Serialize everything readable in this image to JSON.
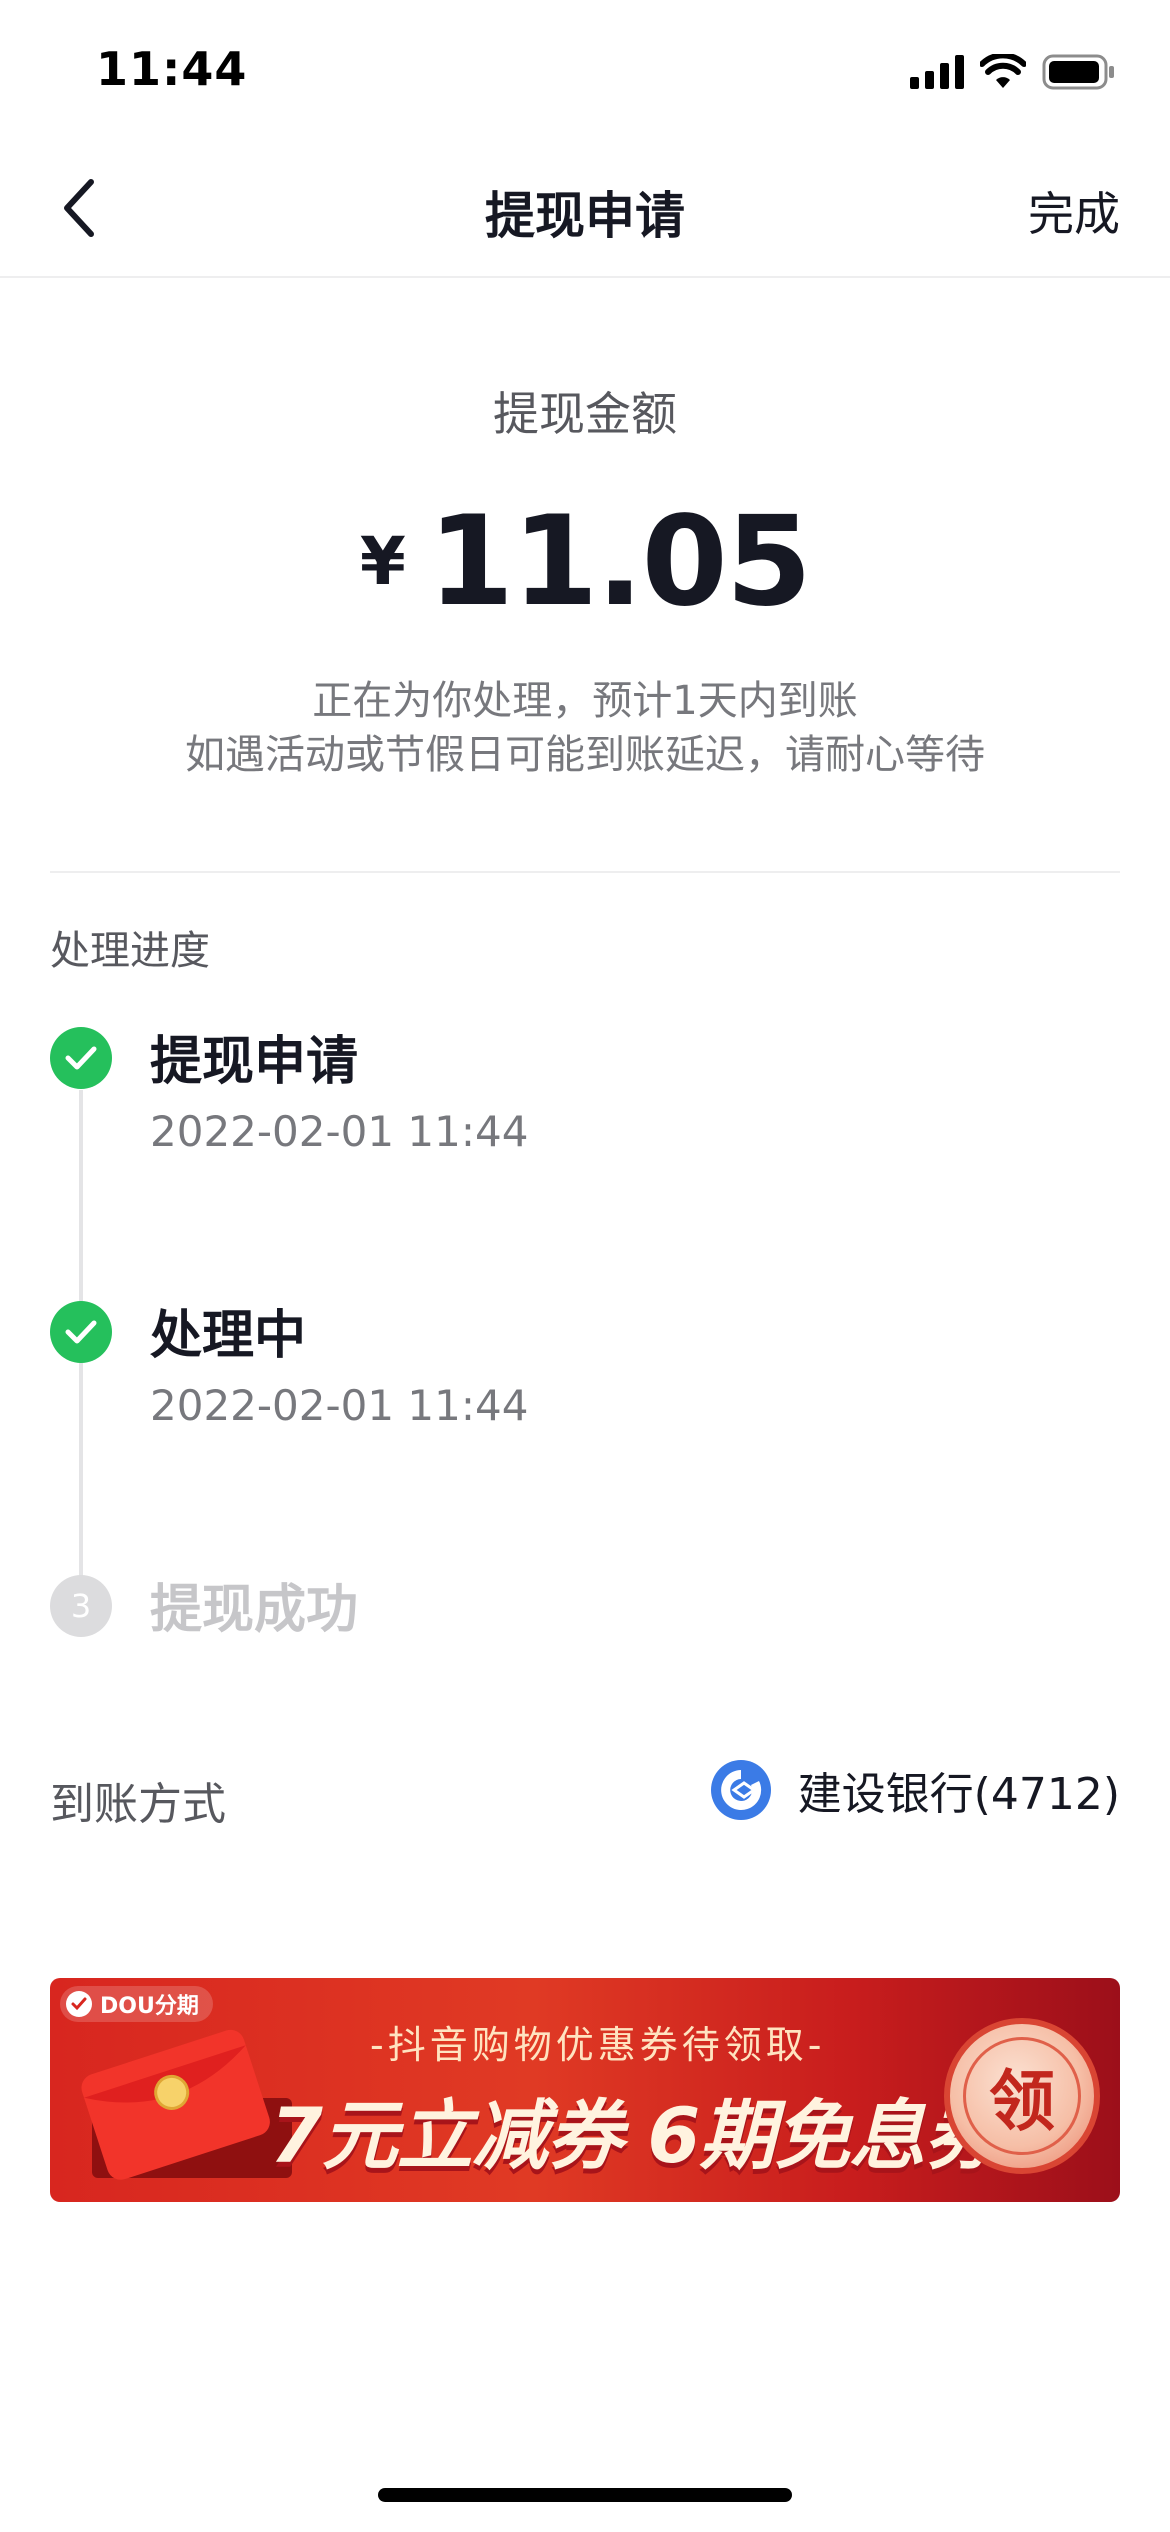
{
  "status_bar": {
    "time": "11:44"
  },
  "nav": {
    "title": "提现申请",
    "done_label": "完成"
  },
  "amount": {
    "label": "提现金额",
    "currency": "¥",
    "value": "11.05",
    "note_line1": "正在为你处理，预计1天内到账",
    "note_line2": "如遇活动或节假日可能到账延迟，请耐心等待"
  },
  "progress": {
    "title": "处理进度",
    "steps": [
      {
        "title": "提现申请",
        "time": "2022-02-01 11:44",
        "status": "done"
      },
      {
        "title": "处理中",
        "time": "2022-02-01 11:44",
        "status": "done"
      },
      {
        "title": "提现成功",
        "number": "3",
        "status": "pending"
      }
    ]
  },
  "arrival": {
    "label": "到账方式",
    "bank": "建设银行(4712)",
    "bank_icon": "ccb-logo-icon"
  },
  "banner": {
    "badge": "DOU分期",
    "subtitle": "-抖音购物优惠券待领取-",
    "main_text": "7元立减券 6期免息券",
    "button": "领"
  },
  "colors": {
    "success": "#25c05c",
    "pending": "#dcdcde",
    "text_primary": "#161823",
    "text_secondary": "#77787d",
    "banner_red": "#d8261f",
    "bank_blue": "#3b7be6"
  }
}
